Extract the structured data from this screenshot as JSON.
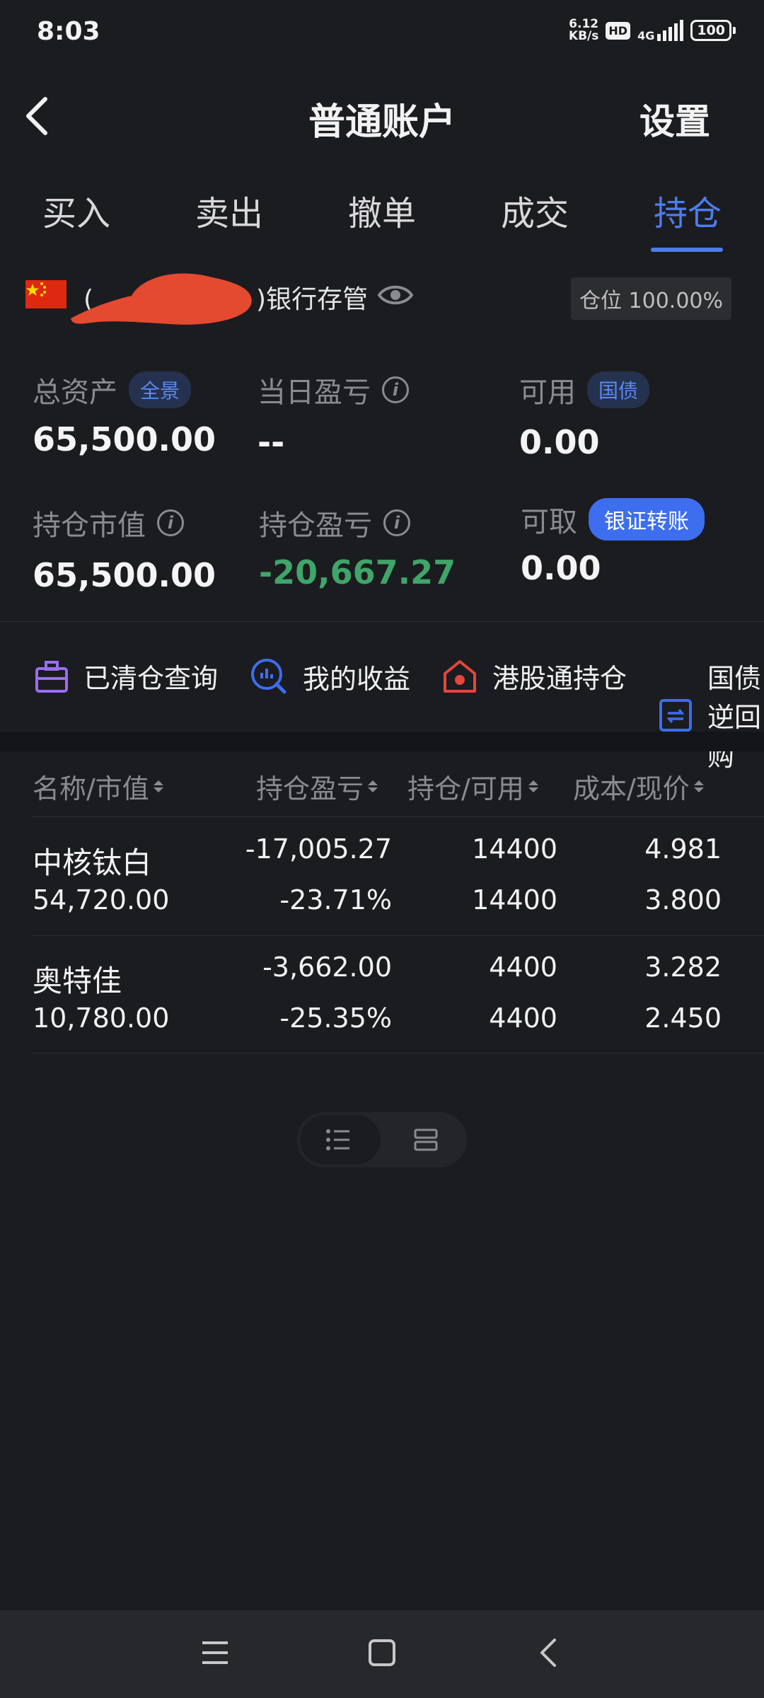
{
  "status_bar": {
    "time": "8:03",
    "net_speed_value": "6.12",
    "net_speed_unit": "KB/s",
    "hd": "HD",
    "network": "4G",
    "battery": "100"
  },
  "header": {
    "title": "普通账户",
    "settings": "设置"
  },
  "tabs": [
    {
      "label": "买入"
    },
    {
      "label": "卖出"
    },
    {
      "label": "撤单"
    },
    {
      "label": "成交"
    },
    {
      "label": "持仓",
      "active": true
    }
  ],
  "account": {
    "name_prefix": "(",
    "name_suffix": ")银行存管",
    "position_ratio": "仓位 100.00%"
  },
  "stats": {
    "total_assets": {
      "label": "总资产",
      "tag": "全景",
      "value": "65,500.00"
    },
    "daily_pl": {
      "label": "当日盈亏",
      "value": "--"
    },
    "available": {
      "label": "可用",
      "tag": "国债",
      "value": "0.00"
    },
    "market_value": {
      "label": "持仓市值",
      "value": "65,500.00"
    },
    "position_pl": {
      "label": "持仓盈亏",
      "value": "-20,667.27"
    },
    "withdrawable": {
      "label": "可取",
      "tag": "银证转账",
      "value": "0.00"
    }
  },
  "quick_entries": [
    {
      "label": "已清仓查询",
      "icon": "briefcase-icon"
    },
    {
      "label": "我的收益",
      "icon": "chart-search-icon"
    },
    {
      "label": "港股通持仓",
      "icon": "hk-house-icon"
    },
    {
      "label": "国债逆回购",
      "icon": "repo-icon"
    }
  ],
  "table": {
    "headers": [
      "名称/市值",
      "持仓盈亏",
      "持仓/可用",
      "成本/现价"
    ],
    "rows": [
      {
        "name": "中核钛白",
        "market_value": "54,720.00",
        "pl": "-17,005.27",
        "pl_pct": "-23.71%",
        "position": "14400",
        "available": "14400",
        "cost": "4.981",
        "price": "3.800"
      },
      {
        "name": "奥特佳",
        "market_value": "10,780.00",
        "pl": "-3,662.00",
        "pl_pct": "-25.35%",
        "position": "4400",
        "available": "4400",
        "cost": "3.282",
        "price": "2.450"
      }
    ]
  },
  "colors": {
    "accent": "#4d7cf0",
    "loss_green": "#3fa56a",
    "background": "#1b1c20"
  }
}
